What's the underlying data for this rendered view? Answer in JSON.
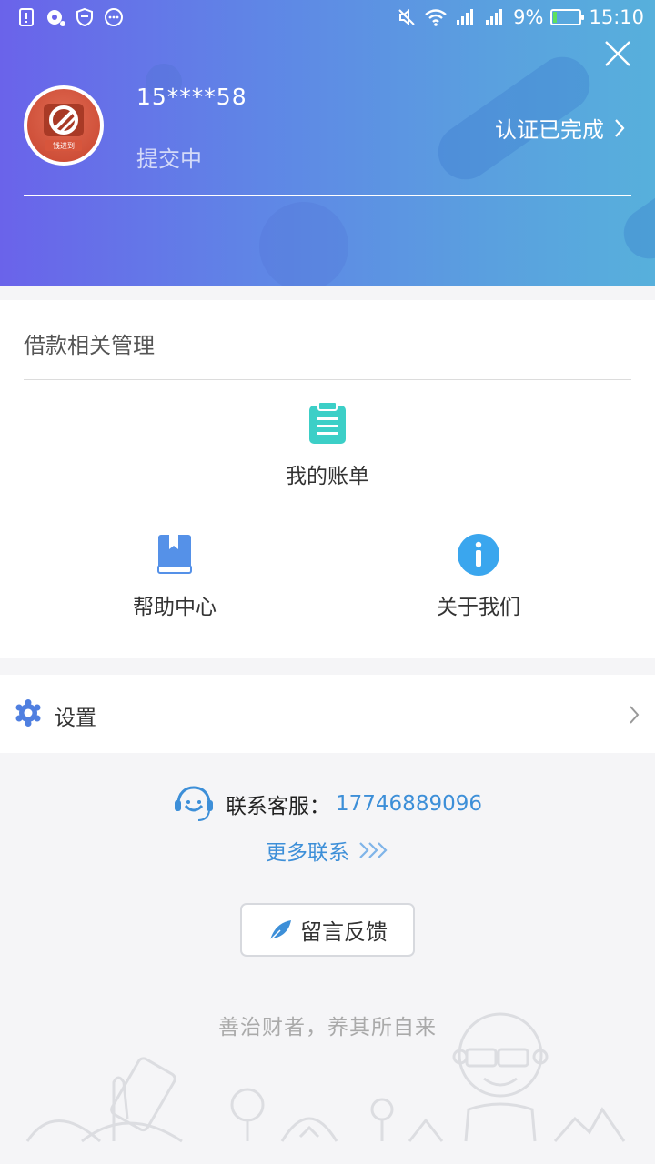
{
  "status_bar": {
    "battery_percent": "9%",
    "time": "15:10"
  },
  "profile": {
    "phone": "15****58",
    "status": "提交中",
    "verify_text": "认证已完成",
    "avatar_text": "钱进到"
  },
  "loan_section": {
    "title": "借款相关管理",
    "items": [
      {
        "label": "我的账单",
        "icon": "bill-icon"
      },
      {
        "label": "帮助中心",
        "icon": "book-icon"
      },
      {
        "label": "关于我们",
        "icon": "info-icon"
      }
    ]
  },
  "settings": {
    "label": "设置"
  },
  "contact": {
    "label": "联系客服：",
    "phone": "17746889096",
    "more_label": "更多联系"
  },
  "feedback": {
    "label": "留言反馈"
  },
  "slogan": "善治财者，养其所自来",
  "colors": {
    "header_gradient_start": "#6a63ea",
    "header_gradient_end": "#57b0dc",
    "accent_blue": "#3d8fd8",
    "bill_teal": "#3ccfc7",
    "book_blue": "#5591e8",
    "info_blue": "#3aa6ee"
  }
}
